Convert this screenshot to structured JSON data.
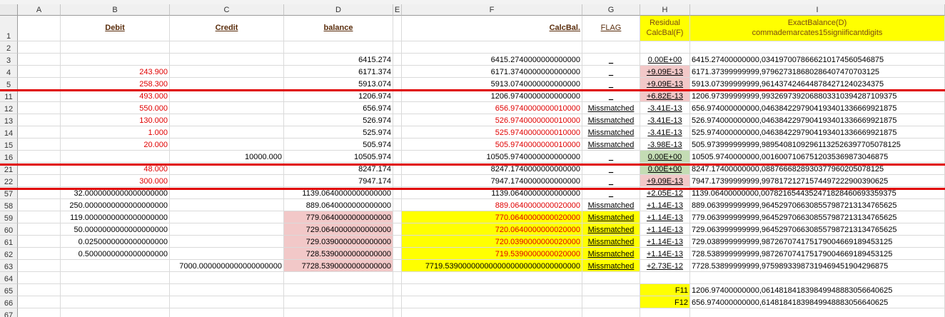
{
  "columns": [
    "A",
    "B",
    "C",
    "D",
    "E",
    "F",
    "G",
    "H",
    "I"
  ],
  "header_row": {
    "row": "1",
    "B": "Debit",
    "C": "Credit",
    "D": "balance",
    "F": "Calc Bal.",
    "G": "FLAG",
    "H_line1": "Residual",
    "H_line2": "Calc Bal (F)",
    "I_line1": "Exact Balance (D)",
    "I_line2": "comma demarcates 15 signiificant digits"
  },
  "rows": [
    {
      "n": "2"
    },
    {
      "n": "3",
      "D": "6415.274",
      "F": "6415.2740000000000000",
      "G": "_",
      "H": "0.00E+00",
      "I": "6415.27400000000,03419700786662101745605468 75"
    },
    {
      "n": "4",
      "B": "243.900",
      "D": "6171.374",
      "F": "6171.3740000000000000",
      "G": "_",
      "H": "+9.09E-13",
      "I": "6171.37399999999,97962731868028640747070312 5"
    },
    {
      "n": "5",
      "B": "258.300",
      "D": "5913.074",
      "F": "5913.0740000000000000",
      "G": "_",
      "H": "+9.09E-13",
      "I": "5913.07399999999,96143742464487842712402343 75"
    },
    {
      "n": "11",
      "B": "493.000",
      "D": "1206.974",
      "F": "1206.9740000000000000",
      "G": "_",
      "H": "+6.82E-13",
      "I": "1206.97399999999,99326973920688033103942871 09375"
    },
    {
      "n": "12",
      "B": "550.000",
      "D": "656.974",
      "F": "656.9740000000010000",
      "G": "Missmatched",
      "H": "-3.41E-13",
      "I": "656.974000000000,04638422979041934013366699 21875"
    },
    {
      "n": "13",
      "B": "130.000",
      "D": "526.974",
      "F": "526.9740000000010000",
      "G": "Missmatched",
      "H": "-3.41E-13",
      "I": "526.974000000000,04638422979041934013366699 21875"
    },
    {
      "n": "14",
      "B": "1.000",
      "D": "525.974",
      "F": "525.9740000000010000",
      "G": "Missmatched",
      "H": "-3.41E-13",
      "I": "525.974000000000,04638422979041934013366699 21875"
    },
    {
      "n": "15",
      "B": "20.000",
      "D": "505.974",
      "F": "505.9740000000010000",
      "G": "Missmatched",
      "H": "-3.98E-13",
      "I": "505.973999999999,98954081092961132526397705 078125"
    },
    {
      "n": "16",
      "C": "10000.000",
      "D": "10505.974",
      "F": "10505.9740000000000000",
      "G": "_",
      "H": "0.00E+00",
      "I": "10505.9740000000,00160071067512035369873046 875"
    },
    {
      "n": "21",
      "B": "48.000",
      "D": "8247.174",
      "F": "8247.1740000000000000",
      "G": "_",
      "H": "0.00E+00",
      "I": "8247.17400000000,08876668289303779602050781 25"
    },
    {
      "n": "22",
      "B": "300.000",
      "D": "7947.174",
      "F": "7947.1740000000000000",
      "G": "_",
      "H": "+9.09E-13",
      "I": "7947.17399999999,99781721271574497222900390 625"
    },
    {
      "n": "57",
      "B": "32.0000000000000000000",
      "D": "1139.0640000000000000",
      "F": "1139.0640000000000000",
      "G": "_",
      "H": "+2.05E-12",
      "I": "1139.06400000000,00782165443524718284606933 59375"
    },
    {
      "n": "58",
      "B": "250.0000000000000000000",
      "D": "889.0640000000000000",
      "F": "889.0640000000020000",
      "G": "Missmatched",
      "H": "+1.14E-13",
      "I": "889.063999999999,96452970663085579872131347 65625"
    },
    {
      "n": "59",
      "B": "119.0000000000000000000",
      "D": "779.0640000000000000",
      "F": "770.0640000000020000",
      "G": "Missmatched",
      "H": "+1.14E-13",
      "I": "779.063999999999,96452970663085579872131347 65625"
    },
    {
      "n": "60",
      "B": "50.0000000000000000000",
      "D": "729.0640000000000000",
      "F": "720.0640000000020000",
      "G": "Missmatched",
      "H": "+1.14E-13",
      "I": "729.063999999999,96452970663085579872131347 65625"
    },
    {
      "n": "61",
      "B": "0.0250000000000000000",
      "D": "729.0390000000000000",
      "F": "720.0390000000020000",
      "G": "Missmatched",
      "H": "+1.14E-13",
      "I": "729.038999999999,98726707417517900466918945 3125"
    },
    {
      "n": "62",
      "B": "0.5000000000000000000",
      "D": "728.5390000000000000",
      "F": "719.5390000000020000",
      "G": "Missmatched",
      "H": "+1.14E-13",
      "I": "728.538999999999,98726707417517900466918945 3125"
    },
    {
      "n": "63",
      "C": "7000.0000000000000000000",
      "D": "7728.5390000000000000",
      "F": "7719.5390000000000000000000000000000",
      "G": "Missmatched",
      "H": "+2.73E-12",
      "I": "7728.53899999999,97598933987319469451904296 875"
    },
    {
      "n": "64"
    },
    {
      "n": "65",
      "H": "F11",
      "I": "1206.97400000000,06148184183984994888305664 0625"
    },
    {
      "n": "66",
      "H": "F12",
      "I": "656.974000000000,61481841839849948883056640 625"
    },
    {
      "n": "67"
    }
  ],
  "colors": {
    "red_line": "#e00000",
    "red_text": "#e00000",
    "yellow": "#ffff00",
    "pink": "#f2c8c8",
    "green": "#c4dcb4"
  }
}
